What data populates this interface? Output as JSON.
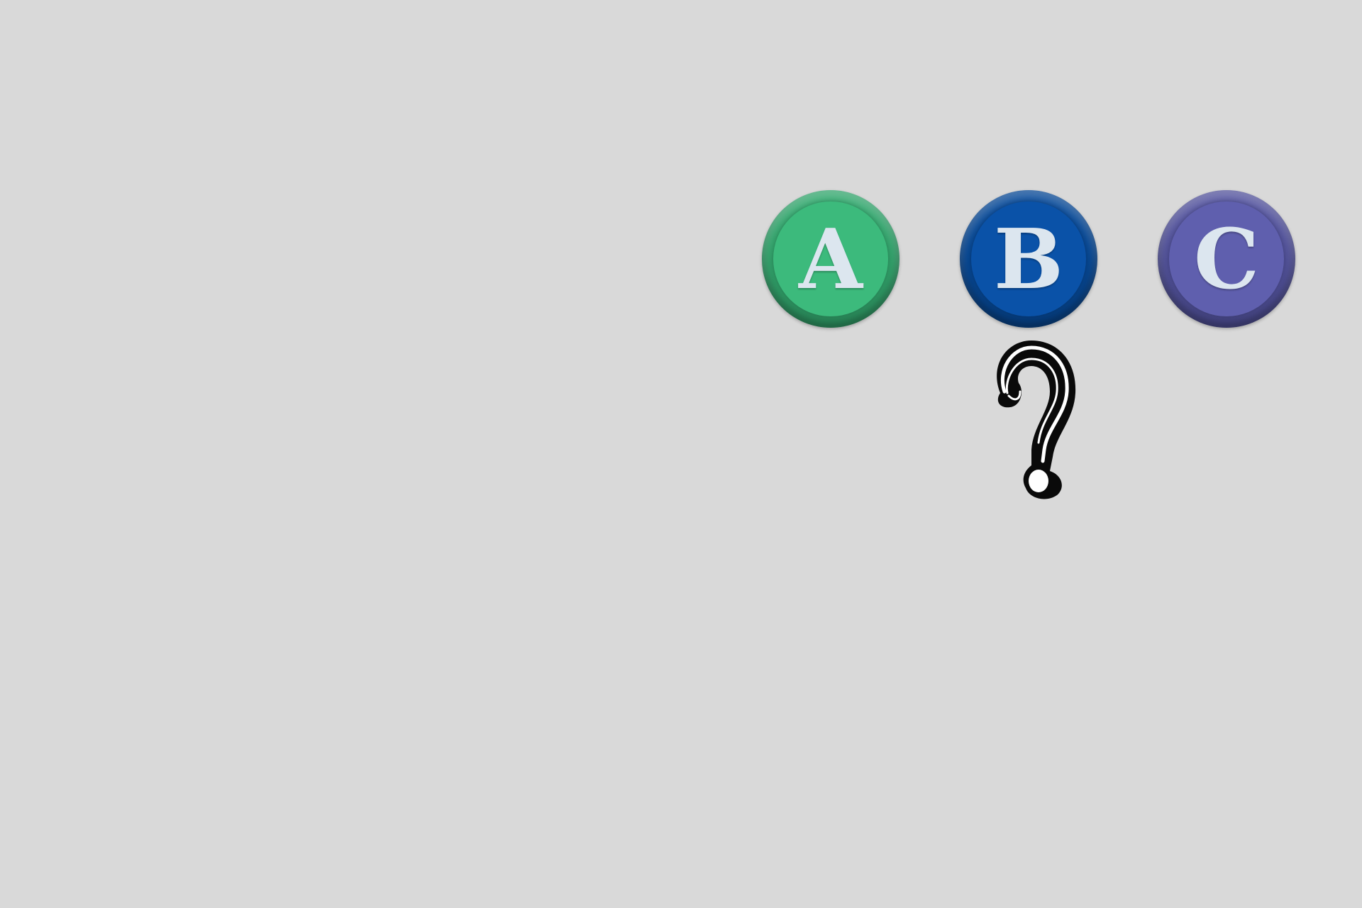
{
  "options": [
    {
      "id": "a",
      "label": "A",
      "color": "#3cba7c",
      "rim": "#2a8d5c"
    },
    {
      "id": "b",
      "label": "B",
      "color": "#0a52a8",
      "rim": "#063e80"
    },
    {
      "id": "c",
      "label": "C",
      "color": "#5f5fae",
      "rim": "#464687"
    }
  ],
  "background_color": "#d9d9d9",
  "prompt_icon": "question-mark-icon"
}
